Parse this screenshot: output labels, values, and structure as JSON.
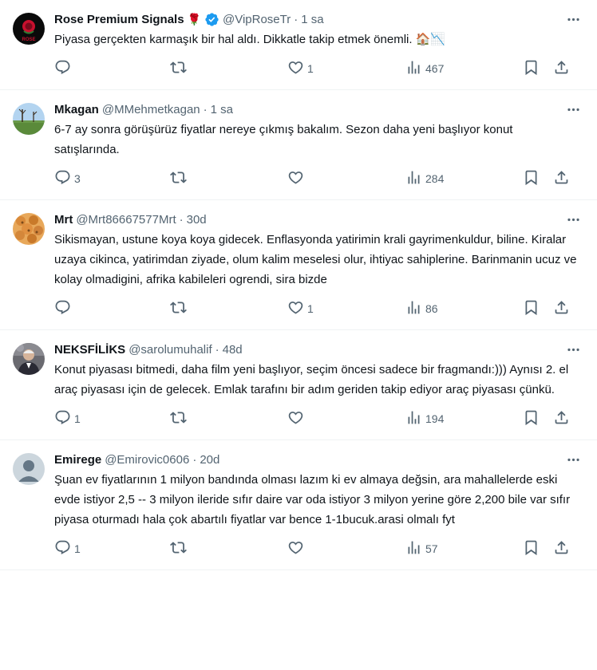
{
  "tweets": [
    {
      "name": "Rose Premium Signals",
      "emoji": "🌹",
      "verified": true,
      "handle": "@VipRoseTr",
      "dot": "·",
      "time": "1 sa",
      "text": "Piyasa gerçekten karmaşık bir hal aldı. Dikkatle takip etmek önemli. 🏠📉",
      "replies": "",
      "retweets": "",
      "likes": "1",
      "views": "467",
      "avatar": "rose-logo",
      "avatar_logo_text": "ROSE"
    },
    {
      "name": "Mkagan",
      "emoji": "",
      "verified": false,
      "handle": "@MMehmetkagan",
      "dot": "·",
      "time": "1 sa",
      "text": "6-7 ay sonra görüşürüz fiyatlar nereye çıkmış bakalım. Sezon daha yeni başlıyor konut satışlarında.",
      "replies": "3",
      "retweets": "",
      "likes": "",
      "views": "284",
      "avatar": "landscape"
    },
    {
      "name": "Mrt",
      "emoji": "",
      "verified": false,
      "handle": "@Mrt86667577Mrt",
      "dot": "·",
      "time": "30d",
      "text": "Sikismayan, ustune koya koya gidecek. Enflasyonda yatirimin krali gayrimenkuldur, biline. Kiralar uzaya cikinca, yatirimdan ziyade, olum kalim meselesi olur, ihtiyac sahiplerine. Barinmanin ucuz ve kolay olmadigini, afrika kabileleri ogrendi, sira bizde",
      "replies": "",
      "retweets": "",
      "likes": "1",
      "views": "86",
      "avatar": "food"
    },
    {
      "name": "NEKSFİLİKS",
      "emoji": "",
      "verified": false,
      "handle": "@sarolumuhalif",
      "dot": "·",
      "time": "48d",
      "text": "Konut piyasası bitmedi, daha film yeni başlıyor, seçim öncesi sadece bir fragmandı:))) Aynısı 2. el araç piyasası için de gelecek. Emlak tarafını bir adım geriden takip ediyor araç piyasası çünkü.",
      "replies": "1",
      "retweets": "",
      "likes": "",
      "views": "194",
      "avatar": "person"
    },
    {
      "name": "Emirege",
      "emoji": "",
      "verified": false,
      "handle": "@Emirovic0606",
      "dot": "·",
      "time": "20d",
      "text": "Şuan ev fiyatlarının 1 milyon bandında olması lazım ki ev almaya değsin, ara mahallelerde eski evde istiyor 2,5 -- 3 milyon ileride sıfır daire var oda istiyor 3 milyon yerine göre 2,200 bile var sıfır piyasa oturmadı hala çok abartılı fiyatlar var bence 1-1bucuk.arasi olmalı fyt",
      "replies": "1",
      "retweets": "",
      "likes": "",
      "views": "57",
      "avatar": "default"
    }
  ],
  "icons": {
    "reply": "reply-icon",
    "retweet": "retweet-icon",
    "like": "like-icon",
    "views": "views-icon",
    "bookmark": "bookmark-icon",
    "share": "share-icon",
    "more": "more-icon",
    "verified": "verified-badge-icon"
  },
  "colors": {
    "text": "#0f1419",
    "muted": "#536471",
    "divider": "#eff3f4",
    "verified": "#1d9bf0"
  }
}
